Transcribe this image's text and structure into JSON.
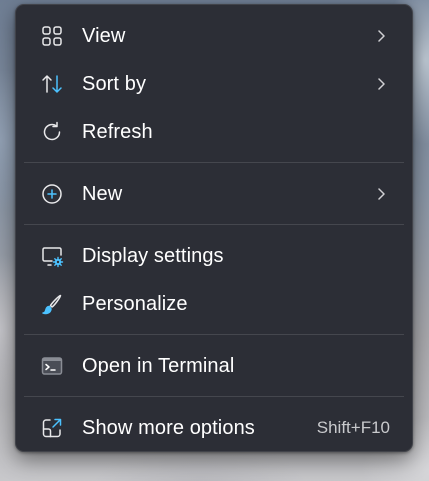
{
  "menu": {
    "items": [
      {
        "label": "View",
        "icon": "grid-view-icon",
        "has_submenu": true
      },
      {
        "label": "Sort by",
        "icon": "sort-arrows-icon",
        "has_submenu": true
      },
      {
        "label": "Refresh",
        "icon": "refresh-icon",
        "has_submenu": false
      },
      {
        "label": "New",
        "icon": "plus-circle-icon",
        "has_submenu": true
      },
      {
        "label": "Display settings",
        "icon": "display-settings-icon",
        "has_submenu": false
      },
      {
        "label": "Personalize",
        "icon": "brush-icon",
        "has_submenu": false
      },
      {
        "label": "Open in Terminal",
        "icon": "terminal-icon",
        "has_submenu": false
      },
      {
        "label": "Show more options",
        "icon": "open-external-icon",
        "has_submenu": false,
        "shortcut": "Shift+F10"
      }
    ]
  },
  "colors": {
    "menu_background": "#2c2e36",
    "text": "#ffffff",
    "shortcut_text": "#c9cacd",
    "accent": "#4cc2ff"
  }
}
